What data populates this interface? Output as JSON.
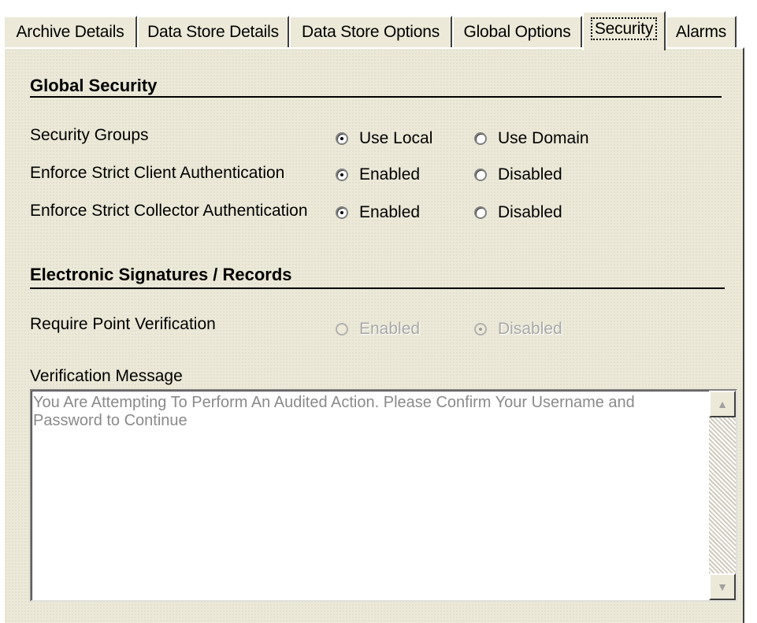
{
  "tabs": [
    {
      "label": "Archive Details",
      "active": false
    },
    {
      "label": "Data Store Details",
      "active": false
    },
    {
      "label": "Data Store Options",
      "active": false
    },
    {
      "label": "Global Options",
      "active": false
    },
    {
      "label": "Security",
      "active": true
    },
    {
      "label": "Alarms",
      "active": false
    }
  ],
  "global_security": {
    "heading": "Global Security",
    "rows": [
      {
        "label": "Security Groups",
        "options": [
          "Use Local",
          "Use Domain"
        ],
        "selected": "Use Local"
      },
      {
        "label": "Enforce Strict Client Authentication",
        "options": [
          "Enabled",
          "Disabled"
        ],
        "selected": "Enabled"
      },
      {
        "label": "Enforce Strict Collector Authentication",
        "options": [
          "Enabled",
          "Disabled"
        ],
        "selected": "Enabled"
      }
    ]
  },
  "electronic_signatures": {
    "heading": "Electronic Signatures / Records",
    "require_point_verification": {
      "label": "Require Point Verification",
      "options": [
        "Enabled",
        "Disabled"
      ],
      "selected": "Disabled",
      "disabled": true
    },
    "verification_message_label": "Verification Message",
    "verification_message_value": "You Are Attempting To Perform An Audited Action.  Please Confirm Your Username and Password to Continue"
  },
  "icons": {
    "scroll_up": "up-arrow-icon",
    "scroll_down": "down-arrow-icon"
  },
  "colors": {
    "panel_background": "#ece9d8",
    "disabled_text": "#a8a8a8",
    "textbox_text": "#8a8a8a"
  }
}
